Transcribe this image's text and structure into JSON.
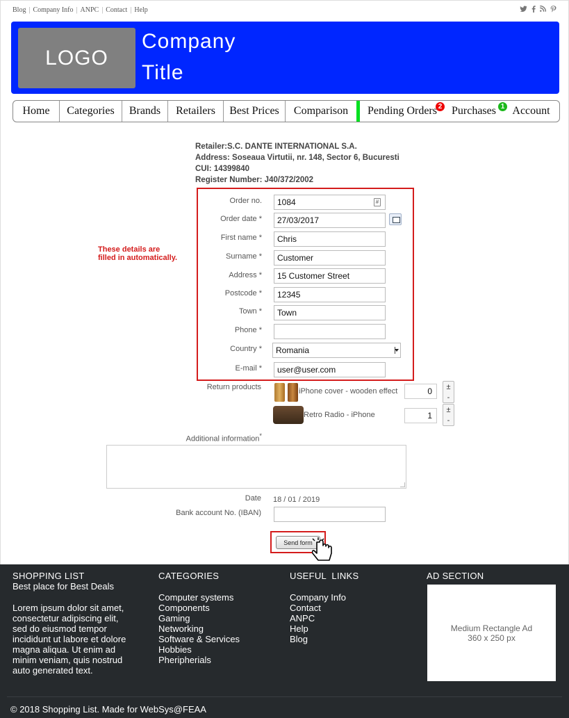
{
  "topbar": {
    "links": [
      "Blog",
      "Company Info",
      "ANPC",
      "Contact",
      "Help"
    ],
    "social_icons": [
      "twitter-icon",
      "facebook-icon",
      "rss-icon",
      "pinterest-icon"
    ]
  },
  "header": {
    "logo_text": "LOGO",
    "title_line1": "Company",
    "title_line2": "Title",
    "bg_color": "#0026ff"
  },
  "nav": {
    "items": [
      "Home",
      "Categories",
      "Brands",
      "Retailers",
      "Best Prices",
      "Comparison",
      "Pending Orders",
      "Purchases",
      "Account"
    ],
    "pending_badge": "2",
    "purchases_badge": "1"
  },
  "retailer": {
    "name": "Retailer:S.C. DANTE INTERNATIONAL S.A.",
    "address": "Address: Soseaua Virtutii, nr. 148, Sector 6, Bucuresti",
    "cui": "CUI: 14399840",
    "register": "Register Number: J40/372/2002"
  },
  "annotation": {
    "line1": "These details are",
    "line2": "filled in automatically."
  },
  "form": {
    "order_no_label": "Order no.",
    "order_no_value": "1084",
    "order_date_label": "Order date *",
    "order_date_value": "27/03/2017",
    "first_name_label": "First name *",
    "first_name_value": "Chris",
    "surname_label": "Surname *",
    "surname_value": "Customer",
    "address_label": "Address *",
    "address_value": "15 Customer Street",
    "postcode_label": "Postcode *",
    "postcode_value": "12345",
    "town_label": "Town *",
    "town_value": "Town",
    "phone_label": "Phone *",
    "phone_value": "",
    "country_label": "Country *",
    "country_value": "Romania",
    "email_label": "E-mail *",
    "email_value": "user@user.com",
    "return_label": "Return products",
    "products": [
      {
        "name": "iPhone cover - wooden effect",
        "qty": "0"
      },
      {
        "name": "Retro Radio - iPhone",
        "qty": "1"
      }
    ],
    "additional_label": "Additional information",
    "additional_star": "*",
    "date_label": "Date",
    "date_value": "18 / 01 / 2019",
    "iban_label": "Bank account No. (IBAN)",
    "iban_value": "",
    "send_label": "Send form"
  },
  "footer": {
    "col1_title": "SHOPPING LIST",
    "col1_subtitle": "Best place for Best Deals",
    "col1_text": [
      "Lorem ipsum dolor sit amet,",
      "consectetur adipiscing elit,",
      "sed do eiusmod tempor",
      "incididunt ut labore et dolore",
      "magna aliqua. Ut enim ad",
      "minim veniam, quis nostrud",
      "auto generated text."
    ],
    "col2_title": "CATEGORIES",
    "col2_items": [
      "Computer systems",
      "Components",
      "Gaming",
      "Networking",
      "Software & Services",
      "Hobbies",
      "Pheripherials"
    ],
    "col3_title": "USEFUL  LINKS",
    "col3_items": [
      "Company Info",
      "Contact",
      "ANPC",
      "Help",
      "Blog"
    ],
    "col4_title": "AD SECTION",
    "ad_line1": "Medium Rectangle Ad",
    "ad_line2": "360 x 250 px",
    "copyright": "© 2018 Shopping List. Made for WebSys@FEAA"
  }
}
